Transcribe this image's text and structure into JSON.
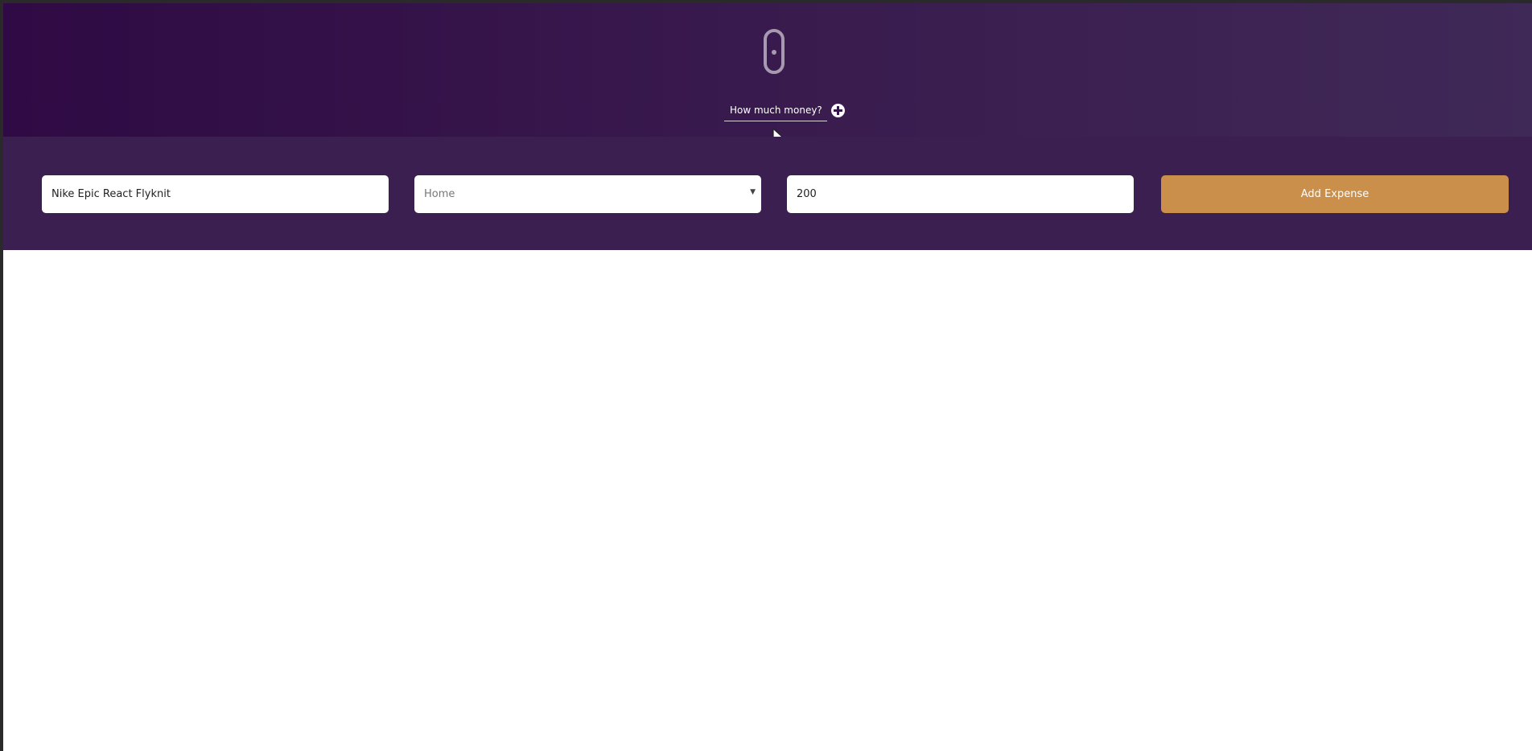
{
  "header": {
    "logo_icon": "mouse-shaped-logo-icon",
    "prompt_label": "How much money?",
    "prompt_icon": "plus-circle-icon"
  },
  "expense_form": {
    "name_value": "Nike Epic React Flyknit",
    "category_value": "Home",
    "category_icon": "chevron-down-icon",
    "amount_value": "200",
    "submit_label": "Add Expense"
  },
  "colors": {
    "header_background_start": "#2f0a44",
    "header_background_end": "#3f2957",
    "form_background": "#3b1f50",
    "button_accent": "#c98f4b",
    "page_background": "#ffffff"
  }
}
